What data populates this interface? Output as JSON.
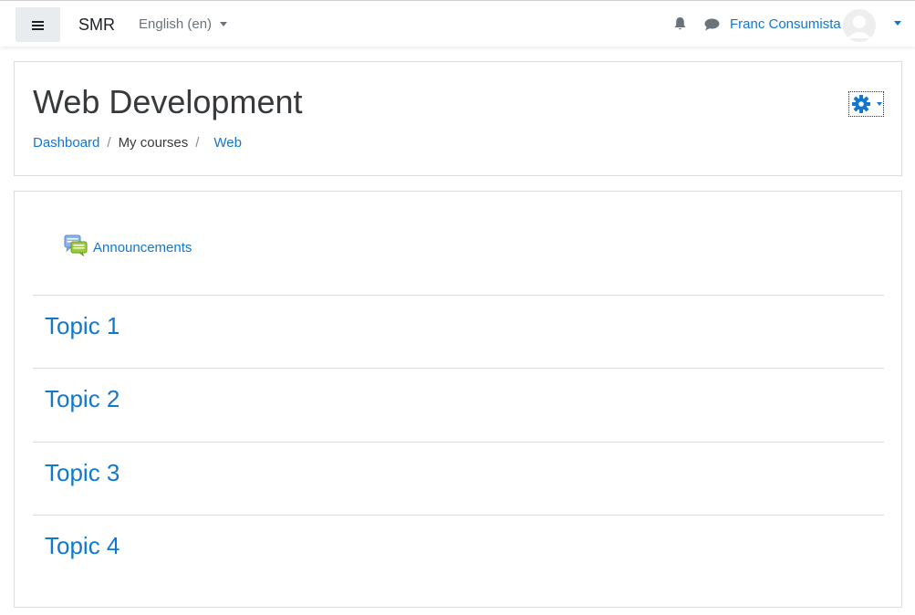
{
  "navbar": {
    "brand": "SMR",
    "language": "English (en)",
    "user_name": "Franc Consumista"
  },
  "header": {
    "title": "Web Development",
    "breadcrumb": [
      "Dashboard",
      "My courses",
      "Web"
    ]
  },
  "course": {
    "announcements_label": "Announcements",
    "sections": [
      "Topic 1",
      "Topic 2",
      "Topic 3",
      "Topic 4"
    ]
  },
  "icons": {
    "menu": "hamburger-icon",
    "notifications": "bell-icon",
    "messages": "chat-icon",
    "settings": "gear-icon",
    "forum": "forum-icon"
  },
  "colors": {
    "link": "#1177d1",
    "text": "#373a3c",
    "menu_button_bg": "#e9ecef"
  }
}
